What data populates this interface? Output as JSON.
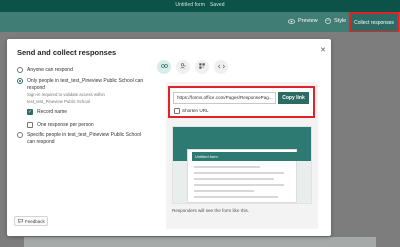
{
  "app": {
    "form_title": "Untitled form",
    "save_status": "Saved"
  },
  "toolbar": {
    "preview_label": "Preview",
    "style_label": "Style",
    "collect_label": "Collect responses"
  },
  "dialog": {
    "title": "Send and collect responses",
    "close_icon": "close-icon",
    "options": {
      "anyone": "Anyone can respond",
      "only_people": "Only people in test_test_Pineview Public School can respond",
      "only_people_note": "Sign-in required to validate access within test_test_Pineview Public School",
      "record_name": "Record name",
      "one_response": "One response per person",
      "specific_people": "Specific people in test_test_Pineview Public School can respond"
    },
    "tabs": [
      {
        "icon": "link-icon",
        "active": true
      },
      {
        "icon": "people-icon",
        "active": false
      },
      {
        "icon": "qr-code-icon",
        "active": false
      },
      {
        "icon": "embed-icon",
        "active": false
      }
    ],
    "link": {
      "url": "https://forms.office.com/Pages/ResponsePag...",
      "copy_label": "Copy link",
      "shorten_label": "Shorten URL"
    },
    "preview": {
      "form_title": "Untitled form",
      "caption": "Responders will see the form like this."
    },
    "feedback_label": "Feedback"
  },
  "colors": {
    "brand": "#2c6b63",
    "highlight": "#e0232b"
  }
}
